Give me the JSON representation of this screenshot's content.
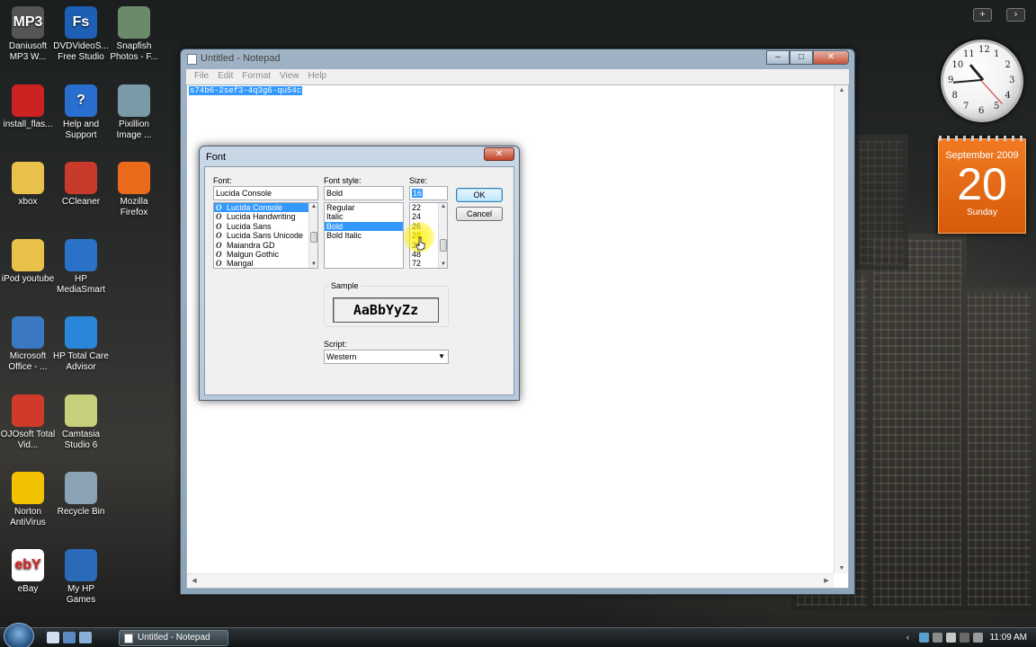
{
  "desktop": {
    "icons": [
      {
        "label": "Daniusoft MP3 W...",
        "badge": "MP3",
        "color": "#555555"
      },
      {
        "label": "install_flas...",
        "badge": "",
        "color": "#cc2222"
      },
      {
        "label": "xbox",
        "badge": "",
        "color": "#e8c04a"
      },
      {
        "label": "iPod youtube",
        "badge": "",
        "color": "#e8c04a"
      },
      {
        "label": "Microsoft Office - ...",
        "badge": "",
        "color": "#3a78c2"
      },
      {
        "label": "OJOsoft Total Vid...",
        "badge": "",
        "color": "#d03a2a"
      },
      {
        "label": "Norton AntiVirus",
        "badge": "",
        "color": "#f2c200"
      },
      {
        "label": "eBay",
        "badge": "ebY",
        "color": "#ffffff"
      },
      {
        "label": "DVDVideoS... Free Studio",
        "badge": "Fs",
        "color": "#1d5fb4"
      },
      {
        "label": "Help and Support",
        "badge": "?",
        "color": "#2a6fd0"
      },
      {
        "label": "CCleaner",
        "badge": "",
        "color": "#c83a2a"
      },
      {
        "label": "HP MediaSmart",
        "badge": "",
        "color": "#2a72c8"
      },
      {
        "label": "HP Total Care Advisor",
        "badge": "",
        "color": "#2a86d8"
      },
      {
        "label": "Camtasia Studio 6",
        "badge": "",
        "color": "#c8cf7a"
      },
      {
        "label": "Recycle Bin",
        "badge": "",
        "color": "#8aa2b4"
      },
      {
        "label": "My HP Games",
        "badge": "",
        "color": "#2a6ab8"
      },
      {
        "label": "Snapfish Photos - F...",
        "badge": "",
        "color": "#6a8a6a"
      },
      {
        "label": "Pixillion Image ...",
        "badge": "",
        "color": "#7a9aa8"
      },
      {
        "label": "Mozilla Firefox",
        "badge": "",
        "color": "#e86a1a"
      }
    ]
  },
  "notepad": {
    "title": "Untitled - Notepad",
    "menu": [
      "File",
      "Edit",
      "Format",
      "View",
      "Help"
    ],
    "selected_text": "s74b6-2sef3-4q3g6-qu54c",
    "controls": {
      "minimize": "–",
      "maximize": "□",
      "close": "✕"
    }
  },
  "font_dialog": {
    "title": "Font",
    "close_glyph": "✕",
    "font_label": "Font:",
    "font_value": "Lucida Console",
    "fonts": [
      {
        "name": "Lucida Console",
        "selected": true
      },
      {
        "name": "Lucida Handwriting",
        "selected": false
      },
      {
        "name": "Lucida Sans",
        "selected": false
      },
      {
        "name": "Lucida Sans Unicode",
        "selected": false
      },
      {
        "name": "Maiandra GD",
        "selected": false
      },
      {
        "name": "Malgun Gothic",
        "selected": false
      },
      {
        "name": "Mangal",
        "selected": false
      }
    ],
    "font_type_glyph": "O",
    "style_label": "Font style:",
    "style_value": "Bold",
    "styles": [
      {
        "name": "Regular",
        "selected": false
      },
      {
        "name": "Italic",
        "selected": false
      },
      {
        "name": "Bold",
        "selected": true
      },
      {
        "name": "Bold Italic",
        "selected": false
      }
    ],
    "size_label": "Size:",
    "size_value": "16",
    "sizes": [
      {
        "name": "22",
        "selected": false
      },
      {
        "name": "24",
        "selected": false
      },
      {
        "name": "26",
        "selected": false
      },
      {
        "name": "28",
        "selected": false
      },
      {
        "name": "36",
        "selected": false
      },
      {
        "name": "48",
        "selected": false
      },
      {
        "name": "72",
        "selected": false
      }
    ],
    "ok_label": "OK",
    "cancel_label": "Cancel",
    "sample_label": "Sample",
    "sample_text": "AaBbYyZz",
    "script_label": "Script:",
    "script_value": "Western"
  },
  "gadgets": {
    "add_glyph": "+",
    "next_glyph": "›",
    "clock_numbers": [
      "12",
      "1",
      "2",
      "3",
      "4",
      "5",
      "6",
      "7",
      "8",
      "9",
      "10",
      "11"
    ],
    "calendar": {
      "month": "September 2009",
      "day": "20",
      "weekday": "Sunday"
    }
  },
  "taskbar": {
    "task_label": "Untitled - Notepad",
    "time": "11:09 AM"
  },
  "colors": {
    "selection": "#3399ff",
    "calendar_orange": "#e86a1a"
  }
}
